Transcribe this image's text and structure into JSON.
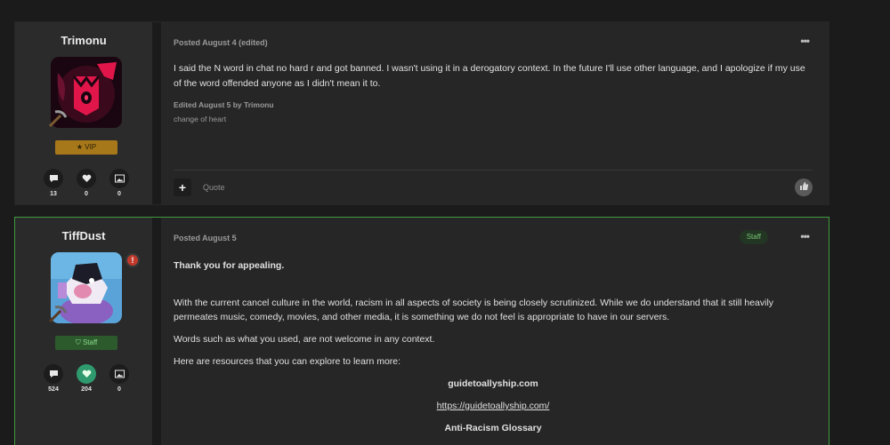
{
  "posts": [
    {
      "author": "Trimonu",
      "badge": "VIP",
      "badge_icon": "star-icon",
      "stats": {
        "posts": "13",
        "reputation": "0",
        "images": "0"
      },
      "meta": "Posted August 4 (edited)",
      "body": "I said the N word in chat no hard r and got banned. I wasn't using it in a derogatory context. In the future I'll use other language, and I apologize if my use of the word offended anyone as I didn't mean it to.",
      "edited": "Edited August 5 by Trimonu",
      "edit_reason": "change of heart",
      "quote_label": "Quote",
      "plus_label": "+",
      "more_label": "•••"
    },
    {
      "author": "TiffDust",
      "badge": "Staff",
      "badge_icon": "shield-icon",
      "avatar_badge": "!",
      "stats": {
        "posts": "524",
        "reputation": "204",
        "images": "0"
      },
      "meta": "Posted August 5",
      "staff_tag": "Staff",
      "more_label": "•••",
      "greeting": "Thank you for appealing.",
      "para1": "With the current cancel culture in the world, racism in all aspects of society is being closely scrutinized.  While we do understand that it still heavily permeates music, comedy, movies, and other media, it is something we do not feel is appropriate to have in our servers.",
      "para2": "Words such as what you used, are not welcome in any context.",
      "para3": "Here are resources that you can explore to learn more:",
      "resource1_title": "guidetoallyship.com",
      "resource1_link": "https://guidetoallyship.com/",
      "resource2_title": "Anti-Racism Glossary"
    }
  ],
  "colors": {
    "staff_border": "#3f9a3f",
    "vip": "#a7781a",
    "liked": "#2e9a6e"
  }
}
